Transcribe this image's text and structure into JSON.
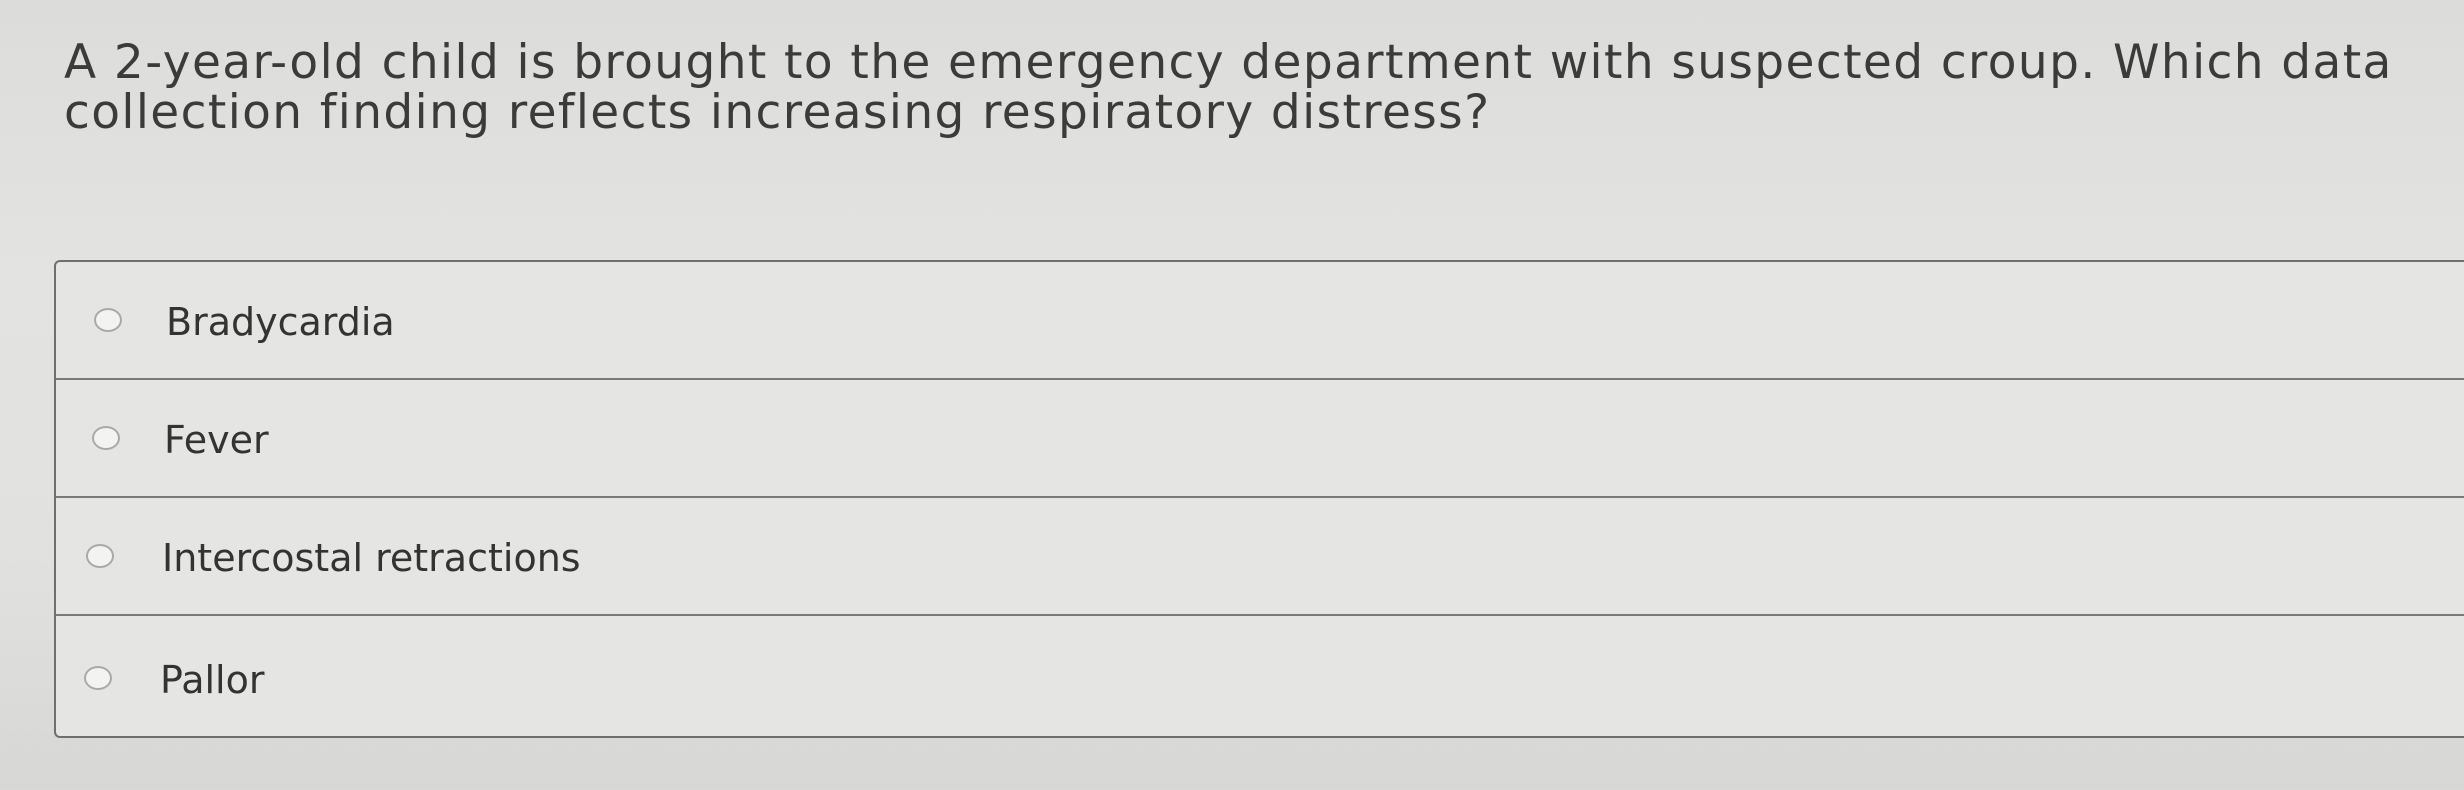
{
  "question": {
    "line1": "A 2-year-old child is brought to the emergency department with suspected croup. Which data",
    "line2": "collection finding reflects increasing respiratory distress?"
  },
  "options": [
    {
      "label": "Bradycardia",
      "selected": false
    },
    {
      "label": "Fever",
      "selected": false
    },
    {
      "label": "Intercostal retractions",
      "selected": false
    },
    {
      "label": "Pallor",
      "selected": false
    }
  ]
}
